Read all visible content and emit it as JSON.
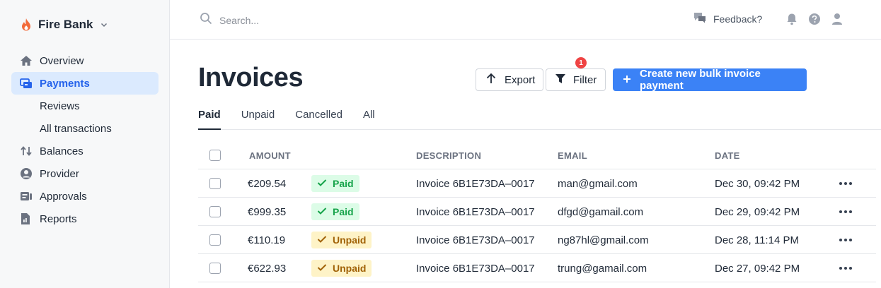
{
  "brand": {
    "name": "Fire Bank"
  },
  "sidebar": {
    "items": [
      {
        "label": "Overview",
        "icon": "home-icon",
        "active": false
      },
      {
        "label": "Payments",
        "icon": "payments-icon",
        "active": true
      },
      {
        "label": "Reviews",
        "sub": true
      },
      {
        "label": "All transactions",
        "sub": true
      },
      {
        "label": "Balances",
        "icon": "swap-arrows-icon"
      },
      {
        "label": "Provider",
        "icon": "user-circle-icon"
      },
      {
        "label": "Approvals",
        "icon": "approvals-icon"
      },
      {
        "label": "Reports",
        "icon": "reports-icon"
      }
    ]
  },
  "topbar": {
    "search_placeholder": "Search...",
    "feedback_label": "Feedback?"
  },
  "page": {
    "title": "Invoices",
    "export_label": "Export",
    "filter_label": "Filter",
    "filter_badge": "1",
    "create_label": "Create new bulk invoice payment"
  },
  "tabs": [
    "Paid",
    "Unpaid",
    "Cancelled",
    "All"
  ],
  "table": {
    "columns": [
      "AMOUNT",
      "DESCRIPTION",
      "EMAIL",
      "DATE"
    ],
    "rows": [
      {
        "amount": "€209.54",
        "status": "Paid",
        "description": "Invoice 6B1E73DA–0017",
        "email": "man@gmail.com",
        "date": "Dec 30, 09:42 PM"
      },
      {
        "amount": "€999.35",
        "status": "Paid",
        "description": "Invoice 6B1E73DA–0017",
        "email": "dfgd@gamail.com",
        "date": "Dec 29, 09:42 PM"
      },
      {
        "amount": "€110.19",
        "status": "Unpaid",
        "description": "Invoice 6B1E73DA–0017",
        "email": "ng87hl@gmail.com",
        "date": "Dec 28, 11:14 PM"
      },
      {
        "amount": "€622.93",
        "status": "Unpaid",
        "description": "Invoice 6B1E73DA–0017",
        "email": "trung@gamail.com",
        "date": "Dec 27, 09:42 PM"
      }
    ]
  },
  "colors": {
    "accent": "#3b82f6",
    "paid": "#16a34a",
    "unpaid": "#a16207",
    "badge": "#ef4444"
  }
}
